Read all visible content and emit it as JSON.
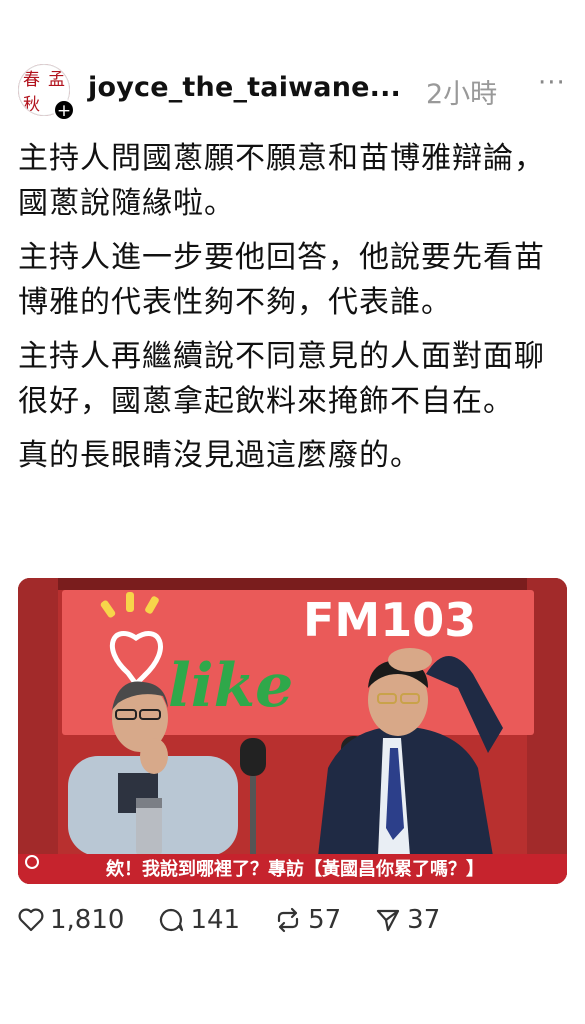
{
  "post": {
    "avatar_chars": [
      "春",
      "孟",
      "秋",
      ""
    ],
    "username": "joyce_the_taiwane...",
    "time": "2小時",
    "more_label": "···",
    "paragraphs": [
      "主持人問國蔥願不願意和苗博雅辯論，國蔥說隨緣啦。",
      "主持人進一步要他回答，他說要先看苗博雅的代表性夠不夠，代表誰。",
      "主持人再繼續說不同意見的人面對面聊很好，國蔥拿起飲料來掩飾不自在。",
      "真的長眼睛沒見過這麼廢的。"
    ]
  },
  "media": {
    "station_label": "FM103",
    "logo_text": "like",
    "caption": "欸！我說到哪裡了？專訪【黃國昌你累了嗎？】",
    "colors": {
      "wall": "#c13a38",
      "banner": "#ea5a59",
      "caption_bar": "#c6232d"
    }
  },
  "actions": {
    "likes": "1,810",
    "replies": "141",
    "reposts": "57",
    "shares": "37"
  }
}
